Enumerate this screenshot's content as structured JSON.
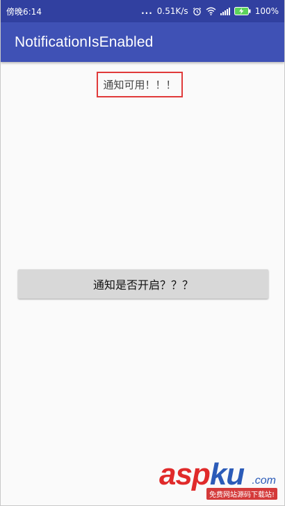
{
  "status_bar": {
    "time": "傍晚6:14",
    "dots": "...",
    "network_speed": "0.51K/s",
    "battery": "100%",
    "icons": [
      "alarm-icon",
      "wifi-icon",
      "signal-icon",
      "battery-charging-icon"
    ]
  },
  "app_bar": {
    "title": "NotificationIsEnabled",
    "color": "#3f51b5"
  },
  "main": {
    "status_text": "通知可用！！！",
    "check_button_label": "通知是否开启？？？"
  },
  "watermark": {
    "brand_red": "asp",
    "brand_blue": "ku",
    "domain": ".com",
    "tagline": "免费网站源码下载站!"
  },
  "colors": {
    "status_bar": "#3140a0",
    "highlight_border": "#e03a3a",
    "button_bg": "#d8d8d8"
  }
}
